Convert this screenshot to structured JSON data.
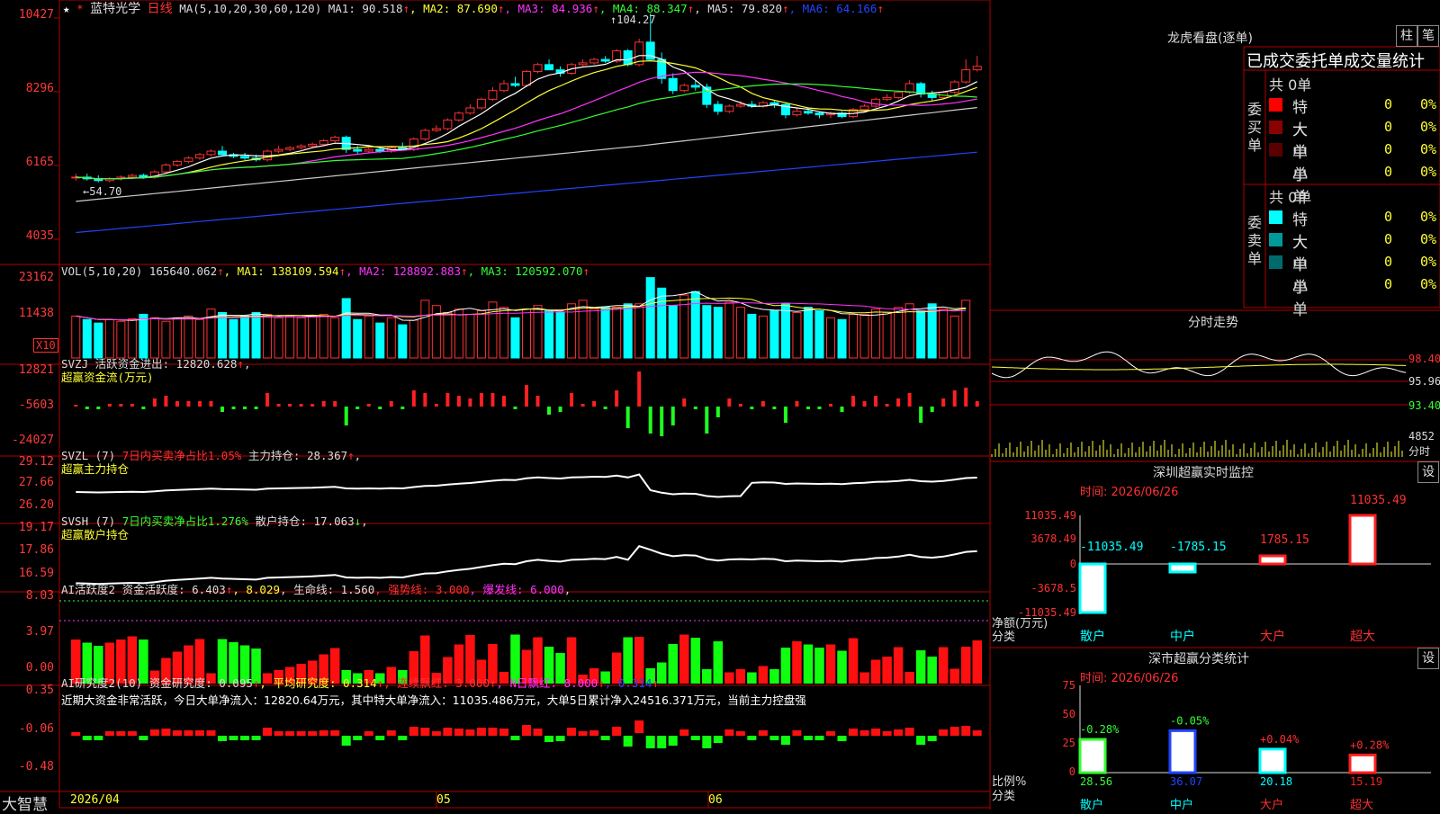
{
  "stock": {
    "star": "★",
    "star2": "*",
    "name": "蓝特光学",
    "period": "日线"
  },
  "headers": {
    "main": [
      {
        "t": "MA(5,10,20,30,60,120)",
        "c": "#dcdcdc"
      },
      {
        "t": " MA1: 90.518",
        "c": "#dcdcdc"
      },
      {
        "t": "↑",
        "c": "#ff3030"
      },
      {
        "t": ", MA2: 87.690",
        "c": "#ffff33"
      },
      {
        "t": "↑",
        "c": "#ff3030"
      },
      {
        "t": ", MA3: 84.936",
        "c": "#ff33ff"
      },
      {
        "t": "↑",
        "c": "#ff3030"
      },
      {
        "t": ", MA4: 88.347",
        "c": "#33ff33"
      },
      {
        "t": "↑",
        "c": "#ff3030"
      },
      {
        "t": ", MA5: 79.820",
        "c": "#dcdcdc"
      },
      {
        "t": "↑",
        "c": "#ff3030"
      },
      {
        "t": ", MA6: 64.166",
        "c": "#2244ff"
      },
      {
        "t": "↑",
        "c": "#ff3030"
      }
    ],
    "vol": [
      {
        "t": "VOL(5,10,20)  165640.062",
        "c": "#dcdcdc"
      },
      {
        "t": "↑",
        "c": "#ff3030"
      },
      {
        "t": ", MA1: 138109.594",
        "c": "#ffff33"
      },
      {
        "t": "↑",
        "c": "#ff3030"
      },
      {
        "t": ", MA2: 128892.883",
        "c": "#ff33ff"
      },
      {
        "t": "↑",
        "c": "#ff3030"
      },
      {
        "t": ", MA3: 120592.070",
        "c": "#33ff33"
      },
      {
        "t": "↑",
        "c": "#ff3030"
      }
    ],
    "svzj": [
      {
        "t": "SVZJ  活跃资金进出: 12820.628",
        "c": "#dcdcdc"
      },
      {
        "t": "↑",
        "c": "#ff3030"
      },
      {
        "t": ",",
        "c": "#dcdcdc"
      }
    ],
    "svzj2": "超赢资金流(万元)",
    "svzl": [
      {
        "t": "SVZL (7) ",
        "c": "#dcdcdc"
      },
      {
        "t": "7日内买卖净占比1.05%",
        "c": "#ff3030"
      },
      {
        "t": " 主力持仓: 28.367",
        "c": "#dcdcdc"
      },
      {
        "t": "↑",
        "c": "#ff3030"
      },
      {
        "t": ",",
        "c": "#dcdcdc"
      }
    ],
    "svzl2": "超赢主力持仓",
    "svsh": [
      {
        "t": "SVSH (7) ",
        "c": "#dcdcdc"
      },
      {
        "t": "7日内买卖净占比1.276%",
        "c": "#33ff33"
      },
      {
        "t": " 散户持仓: 17.063",
        "c": "#dcdcdc"
      },
      {
        "t": "↓",
        "c": "#33ff33"
      },
      {
        "t": ",",
        "c": "#dcdcdc"
      }
    ],
    "svsh2": "超赢散户持仓",
    "ai": [
      {
        "t": "AI活跃度2 资金活跃度: 6.403",
        "c": "#dcdcdc"
      },
      {
        "t": "↑",
        "c": "#ff3030"
      },
      {
        "t": ", 8.029",
        "c": "#ffff33"
      },
      {
        "t": ", 生命线: 1.560",
        "c": "#dcdcdc"
      },
      {
        "t": ", 强势线: 3.000",
        "c": "#ff3030"
      },
      {
        "t": ", 爆发线: 6.000",
        "c": "#ff33ff"
      },
      {
        "t": ",",
        "c": "#dcdcdc"
      }
    ],
    "ai2": [
      {
        "t": "AI研究度2(10) 资金研究度: 0.095",
        "c": "#dcdcdc"
      },
      {
        "t": "↑",
        "c": "#ff3030"
      },
      {
        "t": ", 平均研究度: 0.314",
        "c": "#ffff33"
      },
      {
        "t": "↑",
        "c": "#ff3030"
      },
      {
        "t": ", 连续飘红: 3.000",
        "c": "#ff3030"
      },
      {
        "t": "↑",
        "c": "#ff3030"
      },
      {
        "t": ", N日飘红: 8.000",
        "c": "#ff33ff"
      },
      {
        "t": "↑",
        "c": "#ff3030"
      },
      {
        "t": ", 0.314",
        "c": "#2244ff"
      },
      {
        "t": "↑",
        "c": "#ff3030"
      }
    ],
    "ai2_note": "近期大资金非常活跃，今日大单净流入：12820.64万元，其中特大单净流入：11035.486万元，大单5日累计净入24516.371万元，当前主力控盘强"
  },
  "y_labels": {
    "main": [
      "10427",
      "8296",
      "6165",
      "4035"
    ],
    "vol": [
      "23162",
      "11438"
    ],
    "vol_unit": "X10",
    "svzj": [
      "12821",
      "-5603",
      "-24027"
    ],
    "svzl": [
      "29.12",
      "27.66",
      "26.20"
    ],
    "svsh": [
      "19.17",
      "17.86",
      "16.59"
    ],
    "ai": [
      "8.03",
      "3.97",
      "0.00"
    ],
    "ai2": [
      "0.35",
      "-0.06",
      "-0.48"
    ]
  },
  "annotations": {
    "high": "104.27",
    "low": "54.70",
    "marker_high": "↑",
    "marker_low": "←"
  },
  "x_axis": {
    "start": "2026/04",
    "m1": "05",
    "m2": "06",
    "brand": "大智慧"
  },
  "lhb": {
    "title": "龙虎看盘(逐单)",
    "btn1": "柱",
    "btn2": "笔",
    "heading": "已成交委托单成交量统计",
    "buy_label": "委买单",
    "sell_label": "委卖单",
    "buy_total": "共 0单",
    "sell_total": "共 0单",
    "buy": [
      {
        "name": "特大",
        "count": "0",
        "pct": "0%",
        "color": "#ff0000"
      },
      {
        "name": "大单",
        "count": "0",
        "pct": "0%",
        "color": "#8b0000"
      },
      {
        "name": "中单",
        "count": "0",
        "pct": "0%",
        "color": "#5a0000"
      },
      {
        "name": "小单",
        "count": "0",
        "pct": "0%",
        "color": ""
      }
    ],
    "sell": [
      {
        "name": "特大",
        "count": "0",
        "pct": "0%",
        "color": "#00ffff"
      },
      {
        "name": "大单",
        "count": "0",
        "pct": "0%",
        "color": "#009a9a"
      },
      {
        "name": "中单",
        "count": "0",
        "pct": "0%",
        "color": "#006a6a"
      },
      {
        "name": "小单",
        "count": "0",
        "pct": "0%",
        "color": ""
      }
    ]
  },
  "intraday": {
    "title": "分时走势",
    "p1": "98.40",
    "p2": "95.96",
    "p3": "93.40",
    "vol": "4852",
    "unit": "分时"
  },
  "monitor": {
    "title": "深圳超赢实时监控",
    "btn": "设",
    "time": "时间: 2026/06/26",
    "yticks": [
      "11035.49",
      "3678.49",
      "0",
      "-3678.5",
      "-11035.49"
    ],
    "ylabel": "净额(万元)",
    "xlabel": "分类"
  },
  "stats": {
    "title": "深市超赢分类统计",
    "btn": "设",
    "time": "时间: 2026/06/26",
    "yticks": [
      "75",
      "50",
      "25",
      "0"
    ],
    "ylabel": "比例%",
    "xlabel": "分类"
  },
  "chart_data": [
    {
      "type": "candlestick",
      "title": "蓝特光学 日线",
      "ylim": [
        40.35,
        104.27
      ],
      "ohlc": [
        [
          57,
          58,
          56,
          57
        ],
        [
          57,
          58,
          56,
          56.5
        ],
        [
          56.5,
          57.5,
          55.5,
          56
        ],
        [
          56,
          57,
          55.5,
          56.5
        ],
        [
          56.5,
          57.5,
          56,
          57
        ],
        [
          57,
          58,
          56.5,
          57.5
        ],
        [
          57.5,
          58,
          56.5,
          57
        ],
        [
          57,
          59,
          56.5,
          58.5
        ],
        [
          58.5,
          61,
          58,
          60.5
        ],
        [
          60.5,
          62,
          60,
          61.5
        ],
        [
          61.5,
          63,
          61,
          62.5
        ],
        [
          62.5,
          64,
          62,
          63.5
        ],
        [
          63.5,
          65,
          63,
          64.5
        ],
        [
          64.5,
          66,
          63.5,
          63.5
        ],
        [
          63.5,
          64,
          62.5,
          63
        ],
        [
          63,
          64,
          62,
          62.5
        ],
        [
          62.5,
          63.5,
          61.5,
          62
        ],
        [
          62,
          65,
          61.5,
          64.5
        ],
        [
          64.5,
          66,
          64,
          65
        ],
        [
          65,
          66,
          64.5,
          65.5
        ],
        [
          65.5,
          66.5,
          65,
          66
        ],
        [
          66,
          67,
          65.5,
          66.5
        ],
        [
          66.5,
          68,
          66,
          67.5
        ],
        [
          67.5,
          69,
          67,
          68.5
        ],
        [
          68.5,
          69,
          64,
          65
        ],
        [
          65,
          66,
          63.5,
          64.5
        ],
        [
          64.5,
          65.5,
          64,
          65
        ],
        [
          65,
          65.5,
          64,
          64.5
        ],
        [
          64.5,
          66,
          64,
          65.5
        ],
        [
          65.5,
          67,
          65,
          65
        ],
        [
          65,
          68.5,
          64.5,
          68
        ],
        [
          68,
          71,
          67.5,
          70.5
        ],
        [
          70.5,
          72,
          70,
          71
        ],
        [
          71,
          74,
          70.5,
          73.5
        ],
        [
          73.5,
          76,
          73,
          75.5
        ],
        [
          75.5,
          78,
          75,
          77
        ],
        [
          77,
          80,
          76.5,
          79.5
        ],
        [
          79.5,
          83,
          79,
          82
        ],
        [
          82,
          85,
          81.5,
          84
        ],
        [
          84,
          86,
          83,
          83.5
        ],
        [
          83.5,
          88,
          83,
          87.5
        ],
        [
          87.5,
          90,
          87,
          89.5
        ],
        [
          89.5,
          91,
          88,
          88
        ],
        [
          88,
          89,
          86,
          87
        ],
        [
          87,
          90,
          86.5,
          89.5
        ],
        [
          89.5,
          91,
          89,
          90
        ],
        [
          90,
          91.5,
          89.5,
          91
        ],
        [
          91,
          92,
          90,
          90.5
        ],
        [
          90.5,
          94,
          90,
          93.5
        ],
        [
          93.5,
          94,
          89,
          89.5
        ],
        [
          89.5,
          97,
          89,
          96
        ],
        [
          96,
          104.27,
          95.5,
          91
        ],
        [
          91,
          93,
          84,
          85.5
        ],
        [
          85.5,
          87,
          81,
          82
        ],
        [
          82,
          84,
          81.5,
          83.5
        ],
        [
          83.5,
          85,
          82,
          83
        ],
        [
          83,
          84,
          77,
          78
        ],
        [
          78,
          79,
          75,
          76
        ],
        [
          76,
          78,
          75.5,
          77.5
        ],
        [
          77.5,
          79,
          77,
          78
        ],
        [
          78,
          79,
          77,
          77.5
        ],
        [
          77.5,
          79,
          77,
          78.5
        ],
        [
          78.5,
          79,
          77,
          78
        ],
        [
          78,
          78.5,
          74,
          75
        ],
        [
          75,
          77,
          74.5,
          76
        ],
        [
          76,
          77,
          75,
          75.5
        ],
        [
          75.5,
          76,
          74,
          75
        ],
        [
          75,
          76,
          74,
          75.5
        ],
        [
          75.5,
          76,
          74,
          74.5
        ],
        [
          74.5,
          77,
          74,
          76.5
        ],
        [
          76.5,
          78,
          76,
          77.5
        ],
        [
          77.5,
          80,
          77,
          79.5
        ],
        [
          79.5,
          81,
          79,
          80
        ],
        [
          80,
          82,
          79.5,
          81.5
        ],
        [
          81.5,
          85,
          81,
          84
        ],
        [
          84,
          84.5,
          80,
          81
        ],
        [
          81,
          82,
          79,
          80
        ],
        [
          80,
          82,
          79.5,
          81.5
        ],
        [
          81.5,
          85,
          81,
          84.5
        ],
        [
          84.5,
          91,
          84,
          88
        ],
        [
          88,
          92,
          87.5,
          89
        ]
      ]
    },
    {
      "type": "bar",
      "title": "VOL(5,10,20)",
      "values": [
        12000,
        11000,
        10000,
        11000,
        10500,
        11200,
        12500,
        11500,
        10500,
        11500,
        12000,
        11000,
        14000,
        13000,
        11000,
        12000,
        13000,
        12500,
        11500,
        12000,
        11500,
        12000,
        12500,
        11500,
        17000,
        11000,
        12000,
        10000,
        11500,
        9500,
        10800,
        16500,
        15000,
        13000,
        14000,
        12500,
        13500,
        16000,
        14500,
        11500,
        14000,
        15000,
        13500,
        13000,
        15500,
        16500,
        14000,
        14500,
        14500,
        15500,
        15500,
        23000,
        20000,
        15000,
        18000,
        19000,
        15000,
        14500,
        16000,
        14500,
        12500,
        12000,
        13500,
        15500,
        13000,
        14500,
        13500,
        11500,
        11000,
        12500,
        12500,
        14000,
        13000,
        14500,
        15500,
        13500,
        15500,
        14000,
        12000,
        16500
      ]
    }
  ]
}
